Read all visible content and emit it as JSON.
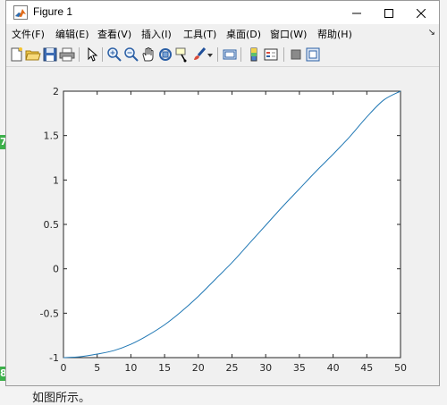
{
  "window": {
    "title": "Figure 1"
  },
  "menu": [
    {
      "label": "文件(F)"
    },
    {
      "label": "编辑(E)"
    },
    {
      "label": "查看(V)"
    },
    {
      "label": "插入(I)"
    },
    {
      "label": "工具(T)"
    },
    {
      "label": "桌面(D)"
    },
    {
      "label": "窗口(W)"
    },
    {
      "label": "帮助(H)"
    }
  ],
  "menu_overflow_glyph": "↘",
  "toolbar": {
    "icons": [
      "new-figure-icon",
      "open-file-icon",
      "save-icon",
      "print-icon",
      "edit-plot-arrow-icon",
      "zoom-in-icon",
      "zoom-out-icon",
      "pan-hand-icon",
      "rotate-3d-icon",
      "data-cursor-icon",
      "brush-icon",
      "brush-dropdown-icon",
      "link-plot-icon",
      "insert-colorbar-icon",
      "insert-legend-icon",
      "hide-plot-tools-icon",
      "show-plot-tools-icon"
    ]
  },
  "background": {
    "badges": [
      "7",
      "8"
    ],
    "caption": "如图所示。"
  },
  "colors": {
    "line": "#1f77b4",
    "axes_bg": "#ffffff",
    "figure_bg": "#f0f0f0",
    "badge": "#3cb04a"
  },
  "chart_data": {
    "type": "line",
    "title": "",
    "xlabel": "",
    "ylabel": "",
    "xlim": [
      0,
      50
    ],
    "ylim": [
      -1,
      2
    ],
    "xticks": [
      "0",
      "5",
      "10",
      "15",
      "20",
      "25",
      "30",
      "35",
      "40",
      "45",
      "50"
    ],
    "yticks": [
      "-1",
      "-0.5",
      "0",
      "0.5",
      "1",
      "1.5",
      "2"
    ],
    "grid": false,
    "series": [
      {
        "x": [
          0,
          2.5,
          5,
          7.5,
          10,
          12.5,
          15,
          17.5,
          20,
          22.5,
          25,
          27.5,
          30,
          32.5,
          35,
          37.5,
          40,
          42.5,
          45,
          47.5,
          50
        ],
        "y": [
          -1,
          -0.99,
          -0.96,
          -0.92,
          -0.85,
          -0.75,
          -0.63,
          -0.48,
          -0.31,
          -0.12,
          0.07,
          0.28,
          0.49,
          0.7,
          0.9,
          1.1,
          1.29,
          1.49,
          1.71,
          1.9,
          2.0
        ]
      }
    ]
  }
}
